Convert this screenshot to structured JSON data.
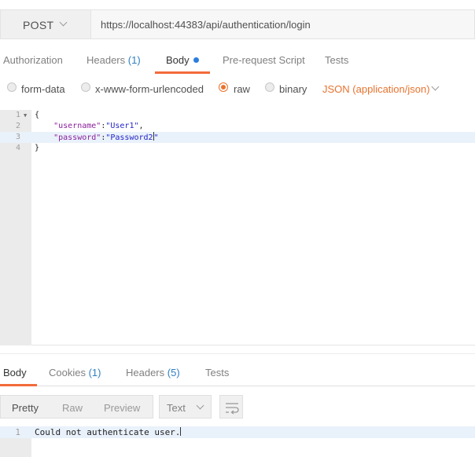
{
  "request": {
    "method": "POST",
    "url": "https://localhost:44383/api/authentication/login"
  },
  "request_tabs": {
    "authorization": "Authorization",
    "headers": "Headers",
    "headers_count": "(1)",
    "body": "Body",
    "prerequest": "Pre-request Script",
    "tests": "Tests"
  },
  "body_options": {
    "form_data": "form-data",
    "urlencoded": "x-www-form-urlencoded",
    "raw": "raw",
    "binary": "binary",
    "selected": "raw",
    "content_type": "JSON (application/json)"
  },
  "editor": {
    "line_numbers": [
      "1",
      "2",
      "3",
      "4"
    ],
    "line1": "{",
    "line2_key": "\"username\"",
    "line2_colon": ":",
    "line2_value": "\"User1\"",
    "line2_comma": ",",
    "line3_key": "\"password\"",
    "line3_colon": ":",
    "line3_value_a": "\"Password2",
    "line3_value_b": "\"",
    "line4": "}"
  },
  "response_tabs": {
    "body": "Body",
    "cookies": "Cookies",
    "cookies_count": "(1)",
    "headers": "Headers",
    "headers_count": "(5)",
    "test_results": "Tests"
  },
  "response_view": {
    "pretty": "Pretty",
    "raw": "Raw",
    "preview": "Preview",
    "format": "Text"
  },
  "response_body": {
    "line_number": "1",
    "text": "Could not authenticate user."
  },
  "colors": {
    "accent": "#f26b3a",
    "content_type": "#e7732f",
    "json_key": "#8b1f9c",
    "json_string": "#2424c4"
  },
  "icons": {
    "method_dropdown": "chevron-down-icon",
    "content_type_dropdown": "chevron-down-icon",
    "format_dropdown": "chevron-down-icon",
    "wrap": "wrap-lines-icon",
    "fold": "fold-arrow-icon",
    "body_modified": "dot-icon"
  }
}
